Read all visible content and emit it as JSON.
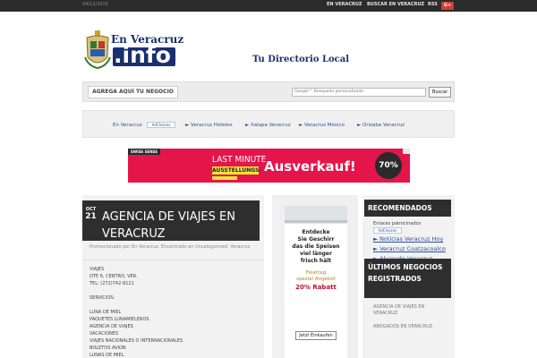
{
  "topbar": {
    "date": "04/12/2015",
    "links": [
      "EN VERACRUZ",
      "BUSCAR EN VERACRUZ",
      "RSS"
    ],
    "gplus": "G+"
  },
  "logo": {
    "top": "En Veracruz",
    "bottom": ".info"
  },
  "tagline": "Tu Directorio Local",
  "nav": {
    "add_business": "AGREGA AQUÍ TU NEGOCIO",
    "search_placeholder": "Google™ Búsqueda personalizada",
    "search_button": "Buscar"
  },
  "linkbar": {
    "site": "En Veracruz",
    "adchoices": "AdChoices",
    "links": [
      "► Veracruz Hoteles",
      "► Xalapa Veracruz",
      "► Veracruz México",
      "► Orizaba Veracruz"
    ]
  },
  "banner": {
    "brand": "SWISS SENSE",
    "line1": "LAST MINUTE",
    "line2": "AUSSTELLUNGS-",
    "line3": "Ausverkauf!",
    "percent": "70%"
  },
  "post": {
    "month": "OCT",
    "day": "21",
    "title": "AGENCIA DE VIAJES EN VERACRUZ",
    "meta": "Promocionado por En Veracruz. Encontrado en Uncategorized, Veracruz",
    "lines": [
      "VIAJES",
      "OTE 6, CENTRO, VER.",
      "TEL: (272)742-8121",
      "",
      "SERVICIOS:",
      "",
      "LUNA DE MIEL",
      "PAQUETES LUNAMIELEROS",
      "AGENCIA DE VIAJES",
      "VACACIONES",
      "VIAJES NACIONALES O INTERNACIONALES",
      "BOLETOS AVION",
      "LUNAS DE MIEL"
    ]
  },
  "middle_ad": {
    "text1": "Entdecke\nSie Geschirr\ndas die Speisen\nviel länger\nfrisch hält",
    "text2": "Feiertag\nspezial Angebot",
    "text3": "20% Rabatt",
    "button": "Jetzt Einkaufen"
  },
  "sidebar": {
    "recommended_title": "RECOMENDADOS",
    "sponsored": "Enlaces patrocinados",
    "adchoices": "AdChoices",
    "links": [
      "► Noticias Veracruz Hoy",
      "► Veracruz Coatzacoalco",
      "► Alvarado Veracruz"
    ],
    "recent_title": "ÚLTIMOS NEGOCIOS REGISTRADOS",
    "recent": [
      "AGENCIA DE VIAJES EN VERACRUZ",
      "ABOGADOS EN VERACRUZ"
    ]
  }
}
